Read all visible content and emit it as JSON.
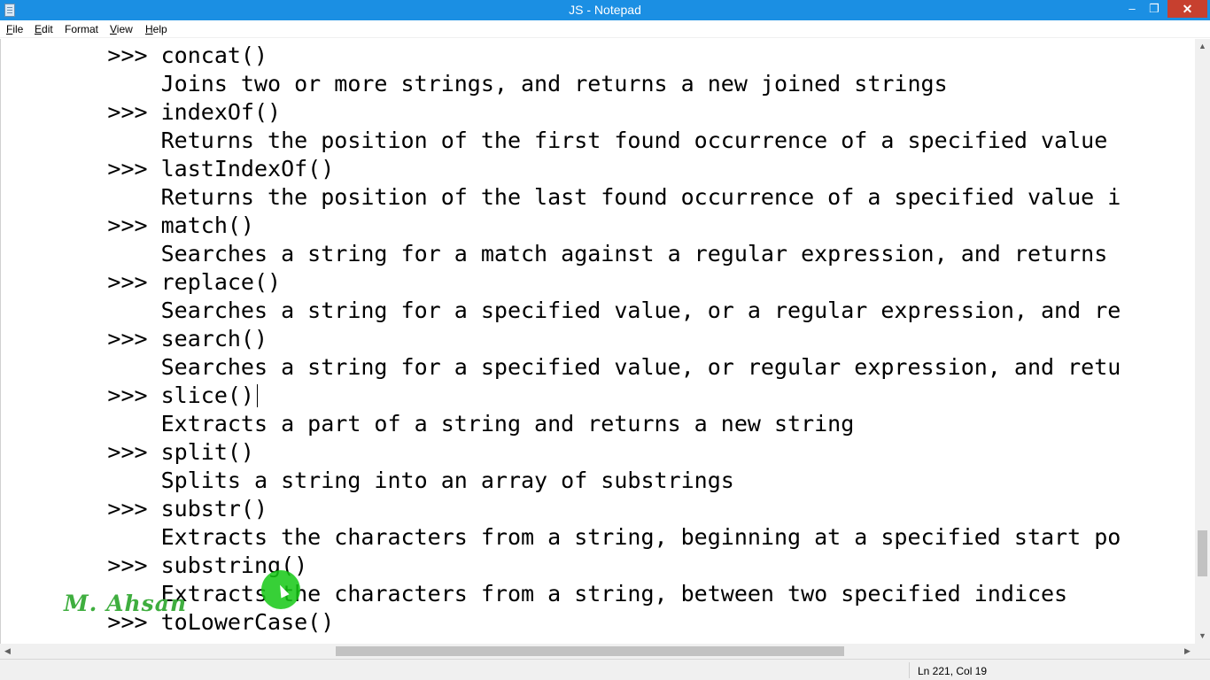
{
  "window": {
    "title": "JS - Notepad",
    "controls": {
      "minimize": "‒",
      "restore": "❐",
      "close": "✕"
    }
  },
  "menu": {
    "items": [
      {
        "accel": "F",
        "rest": "ile"
      },
      {
        "accel": "E",
        "rest": "dit"
      },
      {
        "accel": "",
        "rest": "Format"
      },
      {
        "accel": "V",
        "rest": "iew"
      },
      {
        "accel": "H",
        "rest": "elp"
      }
    ]
  },
  "editor": {
    "lines": [
      "        >>> concat()",
      "            Joins two or more strings, and returns a new joined strings",
      "        >>> indexOf()",
      "            Returns the position of the first found occurrence of a specified value",
      "        >>> lastIndexOf()",
      "            Returns the position of the last found occurrence of a specified value i",
      "        >>> match()",
      "            Searches a string for a match against a regular expression, and returns",
      "        >>> replace()",
      "            Searches a string for a specified value, or a regular expression, and re",
      "        >>> search()",
      "            Searches a string for a specified value, or regular expression, and retu",
      "        >>> slice()",
      "            Extracts a part of a string and returns a new string",
      "        >>> split()",
      "            Splits a string into an array of substrings",
      "        >>> substr()",
      "            Extracts the characters from a string, beginning at a specified start po",
      "        >>> substring()",
      "            Extracts the characters from a string, between two specified indices",
      "        >>> toLowerCase()"
    ]
  },
  "watermark": {
    "text": "M. Ahsan"
  },
  "scrollbars": {
    "vertical": {
      "up": "▲",
      "down": "▼"
    },
    "horizontal": {
      "left": "◀",
      "right": "▶"
    }
  },
  "status": {
    "position": "Ln 221, Col 19"
  }
}
